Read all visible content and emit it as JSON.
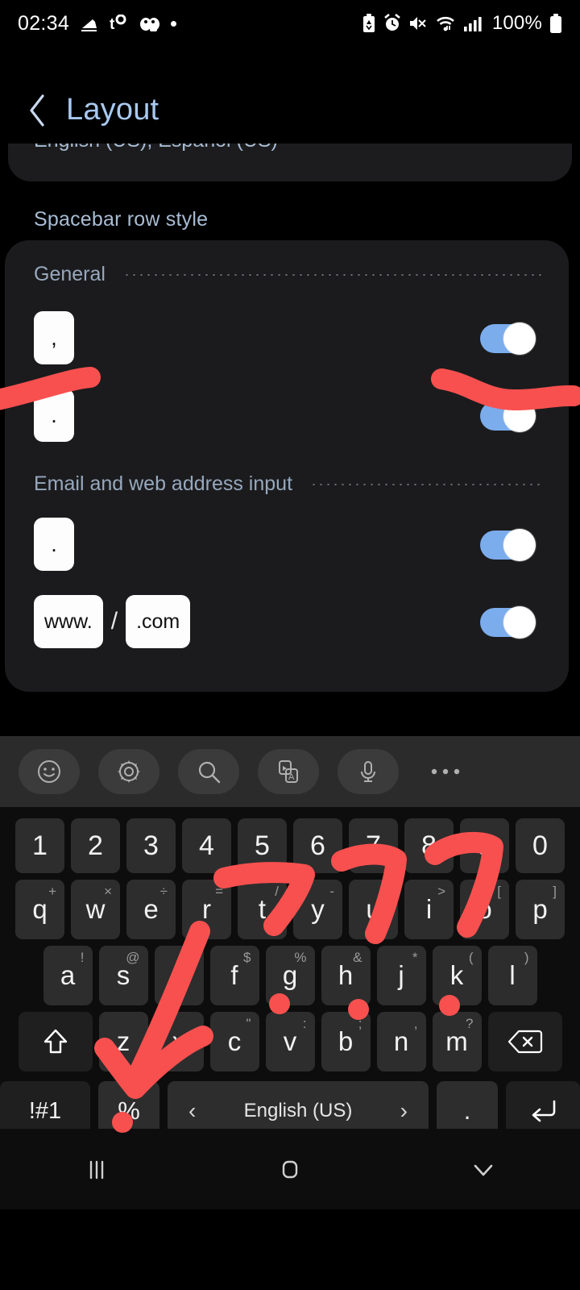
{
  "statusbar": {
    "clock": "02:34",
    "battery_percent": "100%",
    "left_icons": [
      "running-shoe-icon",
      "temperature-t-icon",
      "game-controller-icon",
      "dot-icon"
    ],
    "right_icons": [
      "battery-saver-icon",
      "alarm-icon",
      "mute-vibrate-icon",
      "wifi-icon",
      "signal-bars-icon"
    ]
  },
  "appbar": {
    "back_label": "Back",
    "title": "Layout"
  },
  "content": {
    "clipped_card_text": "English (US), Español (US)",
    "section_header": "Spacebar row style",
    "groups": [
      {
        "label": "General",
        "rows": [
          {
            "keys": [
              ","
            ],
            "toggle_on": true
          },
          {
            "keys": [
              "."
            ],
            "toggle_on": true
          }
        ]
      },
      {
        "label": "Email and web address input",
        "rows": [
          {
            "keys": [
              "."
            ],
            "toggle_on": true
          },
          {
            "keys": [
              "www.",
              ".com"
            ],
            "separator": "/",
            "toggle_on": true
          }
        ]
      }
    ]
  },
  "keyboard": {
    "toolbar_icons": [
      "emoji-icon",
      "gear-icon",
      "search-icon",
      "translate-icon",
      "microphone-icon",
      "more-options-icon"
    ],
    "rows": {
      "numbers": [
        "1",
        "2",
        "3",
        "4",
        "5",
        "6",
        "7",
        "8",
        "9",
        "0"
      ],
      "top": [
        {
          "main": "q",
          "sup": "+"
        },
        {
          "main": "w",
          "sup": "×"
        },
        {
          "main": "e",
          "sup": "÷"
        },
        {
          "main": "r",
          "sup": "="
        },
        {
          "main": "t",
          "sup": "/"
        },
        {
          "main": "y",
          "sup": "-"
        },
        {
          "main": "u",
          "sup": ""
        },
        {
          "main": "i",
          "sup": ">"
        },
        {
          "main": "o",
          "sup": "["
        },
        {
          "main": "p",
          "sup": "]"
        }
      ],
      "home": [
        {
          "main": "a",
          "sup": "!"
        },
        {
          "main": "s",
          "sup": "@"
        },
        {
          "main": "d",
          "sup": "#"
        },
        {
          "main": "f",
          "sup": "$"
        },
        {
          "main": "g",
          "sup": "%"
        },
        {
          "main": "h",
          "sup": "&"
        },
        {
          "main": "j",
          "sup": "*"
        },
        {
          "main": "k",
          "sup": "("
        },
        {
          "main": "l",
          "sup": ")"
        }
      ],
      "bottom": [
        {
          "main": "z",
          "sup": ""
        },
        {
          "main": "x",
          "sup": ""
        },
        {
          "main": "c",
          "sup": "\""
        },
        {
          "main": "v",
          "sup": ":"
        },
        {
          "main": "b",
          "sup": ";"
        },
        {
          "main": "n",
          "sup": ","
        },
        {
          "main": "m",
          "sup": "?"
        }
      ],
      "shift_label": "shift-icon",
      "backspace_label": "backspace-icon"
    },
    "symbols_key": "!#1",
    "percent_key": "%",
    "space_language": "English (US)",
    "space_prev": "‹",
    "space_next": "›",
    "period_key": ".",
    "enter_key": "enter-icon"
  },
  "navbar": {
    "recents": "recents-icon",
    "home": "home-icon",
    "hide_keyboard": "hide-keyboard-icon"
  },
  "colors": {
    "accent_title": "#a8c8f0",
    "toggle_on": "#7bacec",
    "card_bg": "#1b1b1d",
    "key_bg": "#2d2d2d",
    "annotation_red": "#f8504f"
  }
}
